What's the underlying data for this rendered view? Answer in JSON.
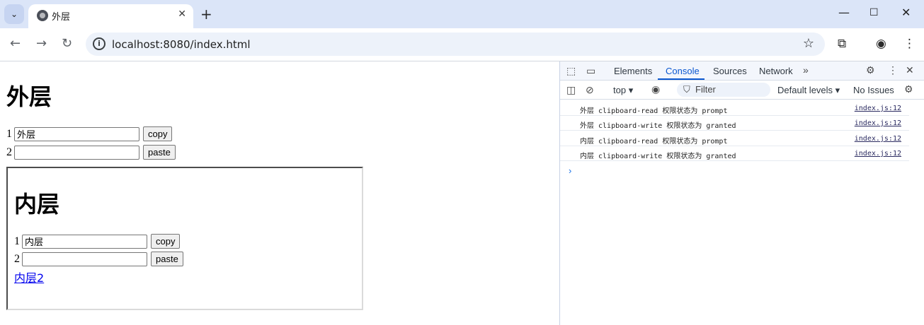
{
  "browser": {
    "tab_title": "外层",
    "url": "localhost:8080/index.html"
  },
  "page": {
    "outer": {
      "heading": "外层",
      "row1_num": "1",
      "row1_value": "外层",
      "copy_label": "copy",
      "row2_num": "2",
      "row2_value": "",
      "paste_label": "paste"
    },
    "inner": {
      "heading": "内层",
      "row1_num": "1",
      "row1_value": "内层",
      "copy_label": "copy",
      "row2_num": "2",
      "row2_value": "",
      "paste_label": "paste",
      "link_label": "内层2"
    }
  },
  "devtools": {
    "tabs": [
      "Elements",
      "Console",
      "Sources",
      "Network"
    ],
    "active_tab": "Console",
    "context": "top",
    "filter_placeholder": "Filter",
    "levels": "Default levels",
    "issues": "No Issues",
    "console": [
      {
        "msg": "外层 clipboard-read 权限状态为 prompt",
        "src": "index.js:12"
      },
      {
        "msg": "外层 clipboard-write 权限状态为 granted",
        "src": "index.js:12"
      },
      {
        "msg": "内层 clipboard-read 权限状态为 prompt",
        "src": "index.js:12"
      },
      {
        "msg": "内层 clipboard-write 权限状态为 granted",
        "src": "index.js:12"
      }
    ]
  }
}
